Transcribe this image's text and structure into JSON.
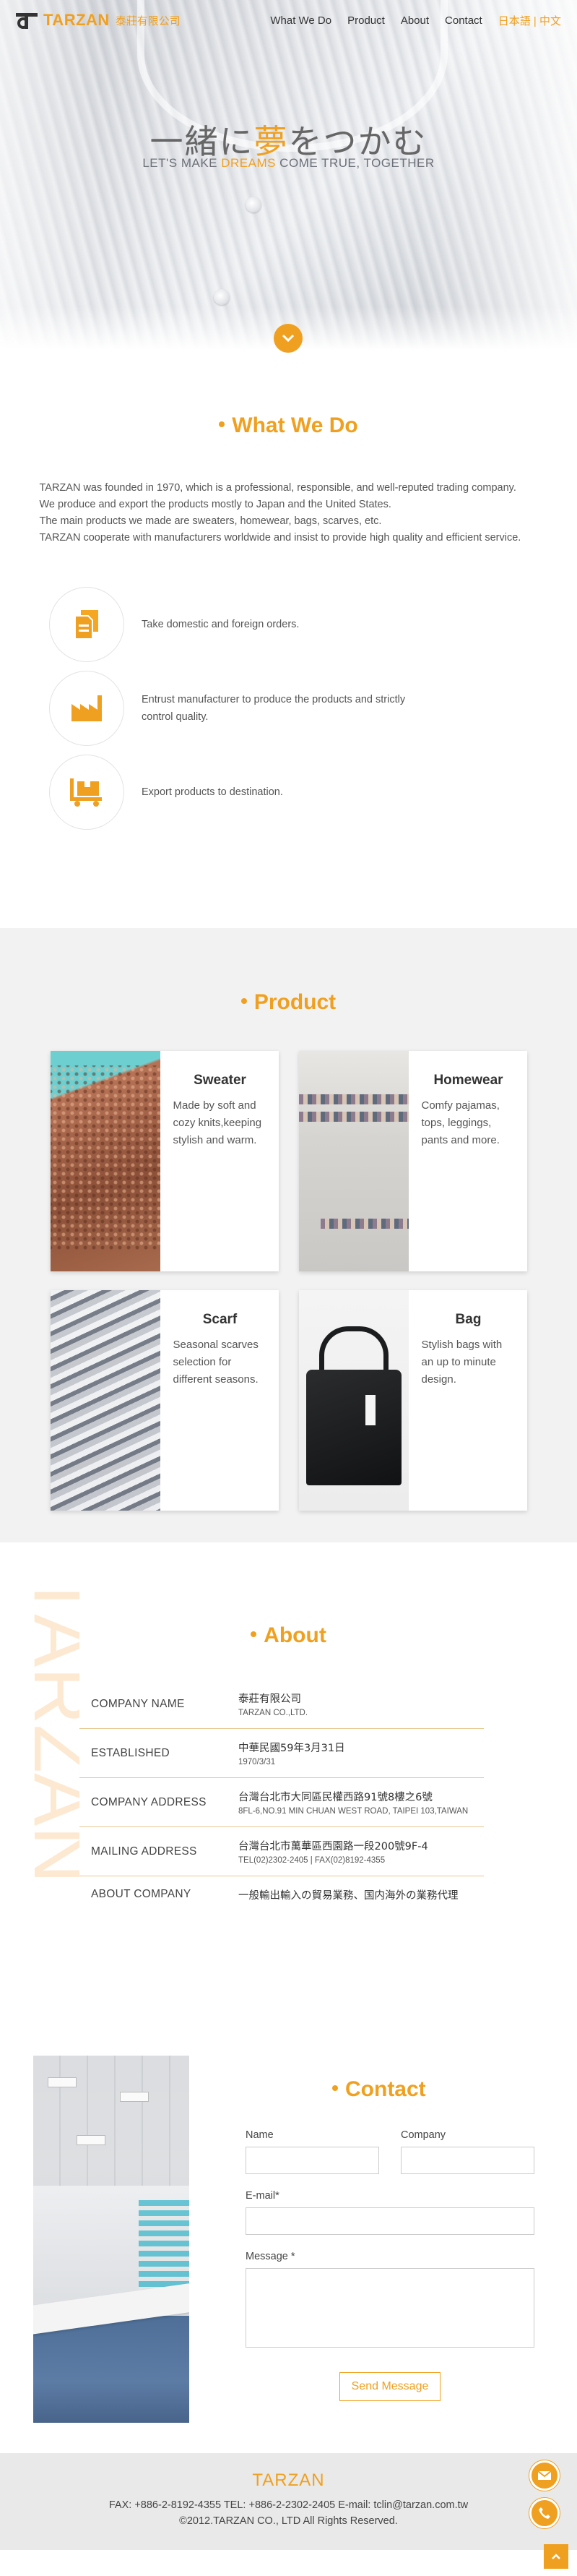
{
  "brand": {
    "name": "TARZAN",
    "chinese_name": "泰莊有限公司",
    "accent_color": "#f0a020"
  },
  "nav": {
    "items": [
      "What We Do",
      "Product",
      "About",
      "Contact"
    ],
    "lang_ja": "日本語",
    "lang_sep": "|",
    "lang_zh": "中文"
  },
  "hero": {
    "title_part1": "一緒に",
    "title_highlight": "夢",
    "title_part2": "をつかむ",
    "subtitle_part1": "LET'S MAKE ",
    "subtitle_highlight": "DREAMS",
    "subtitle_part2": " COME TRUE, TOGETHER",
    "scroll_icon": "chevron-down-icon"
  },
  "whatwedo": {
    "title": "What We Do",
    "intro": [
      "TARZAN was founded in 1970, which is a professional, responsible, and well-reputed trading company.",
      "We produce and export the products mostly to Japan and the United States.",
      "The main products we made are sweaters, homewear, bags, scarves, etc.",
      "TARZAN cooperate with manufacturers worldwide and insist to provide high quality and efficient service."
    ],
    "services": [
      {
        "icon": "document-icon",
        "text": "Take domestic and foreign orders."
      },
      {
        "icon": "factory-icon",
        "text": "Entrust manufacturer to produce the products and strictly control quality."
      },
      {
        "icon": "forklift-icon",
        "text": "Export products to destination."
      }
    ]
  },
  "product": {
    "title": "Product",
    "items": [
      {
        "name": "Sweater",
        "desc": "Made by soft and cozy knits,keeping stylish and warm."
      },
      {
        "name": "Homewear",
        "desc": "Comfy pajamas, tops, leggings, pants and more."
      },
      {
        "name": "Scarf",
        "desc": "Seasonal scarves selection for different seasons."
      },
      {
        "name": "Bag",
        "desc": "Stylish bags with an up to minute design."
      }
    ]
  },
  "about": {
    "title": "About",
    "watermark": "TARZAN",
    "rows": [
      {
        "label": "COMPANY NAME",
        "main": "泰莊有限公司",
        "small": "TARZAN CO.,LTD."
      },
      {
        "label": "ESTABLISHED",
        "main": "中華民國59年3月31日",
        "small": "1970/3/31"
      },
      {
        "label": "COMPANY ADDRESS",
        "main": "台灣台北市大同區民權西路91號8樓之6號",
        "small": "8FL-6,NO.91 MIN CHUAN WEST ROAD, TAIPEI 103,TAIWAN"
      },
      {
        "label": "MAILING ADDRESS",
        "main": "台灣台北市萬華區西園路一段200號9F-4",
        "small": "TEL(02)2302-2405 | FAX(02)8192-4355"
      },
      {
        "label": "ABOUT COMPANY",
        "main": "一般輸出輸入の貿易業務、国内海外の業務代理",
        "small": ""
      }
    ]
  },
  "contact": {
    "title": "Contact",
    "name_label": "Name",
    "company_label": "Company",
    "email_label": "E-mail*",
    "message_label": "Message *",
    "send_label": "Send Message"
  },
  "footer": {
    "brand": "TARZAN",
    "contact_line": "FAX: +886-2-8192-4355    TEL: +886-2-2302-2405    E-mail: tclin@tarzan.com.tw",
    "copyright": "©2012.TARZAN CO., LTD All Rights Reserved."
  },
  "floating": {
    "mail_icon": "mail-icon",
    "phone_icon": "phone-icon",
    "top_icon": "chevron-up-icon"
  }
}
